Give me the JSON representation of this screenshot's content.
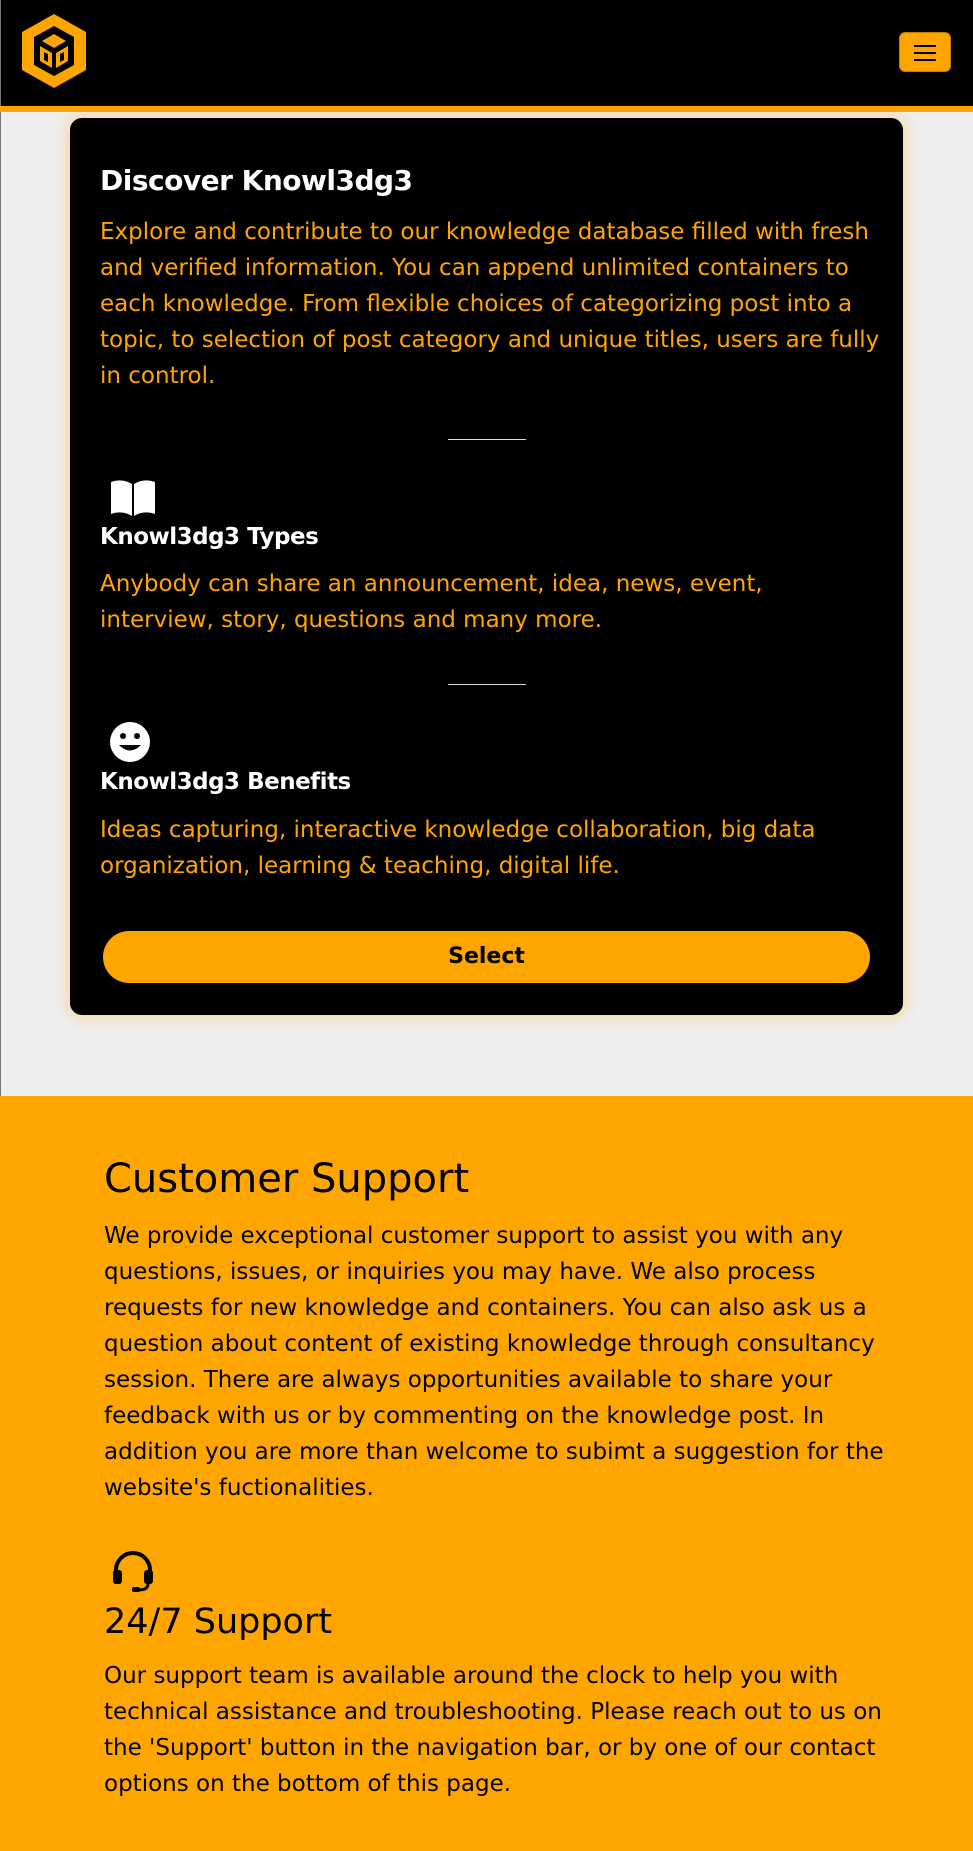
{
  "navbar": {
    "logo_icon": "cube-logo-icon",
    "menu_icon": "hamburger-menu-icon",
    "accent_color": "#ffa500"
  },
  "discover_card": {
    "title": "Discover Knowl3dg3",
    "description": "Explore and contribute to our knowledge database filled with fresh and verified information. You can append unlimited containers to each knowledge. From flexible choices of categorizing post into a topic, to selection of post category and unique titles, users are fully in control.",
    "features": [
      {
        "icon": "open-book-icon",
        "title": "Knowl3dg3 Types",
        "text": "Anybody can share an announcement, idea, news, event, interview, story, questions and many more."
      },
      {
        "icon": "smiley-face-icon",
        "title": "Knowl3dg3 Benefits",
        "text": "Ideas capturing, interactive knowledge collaboration, big data organization, learning & teaching, digital life."
      }
    ],
    "button_label": "Select"
  },
  "customer_support": {
    "title": "Customer Support",
    "text": "We provide exceptional customer support to assist you with any questions, issues, or inquiries you may have. We also process requests for new knowledge and containers. You can also ask us a question about content of existing knowledge through consultancy session. There are always opportunities available to share your feedback with us or by commenting on the knowledge post. In addition you are more than welcome to subimt a suggestion for the website's fuctionalities.",
    "support_icon": "headset-icon",
    "subtitle": "24/7 Support",
    "subtext": "Our support team is available around the clock to help you with technical assistance and troubleshooting. Please reach out to us on the 'Support' button in the navigation bar, or by one of our contact options on the bottom of this page."
  }
}
